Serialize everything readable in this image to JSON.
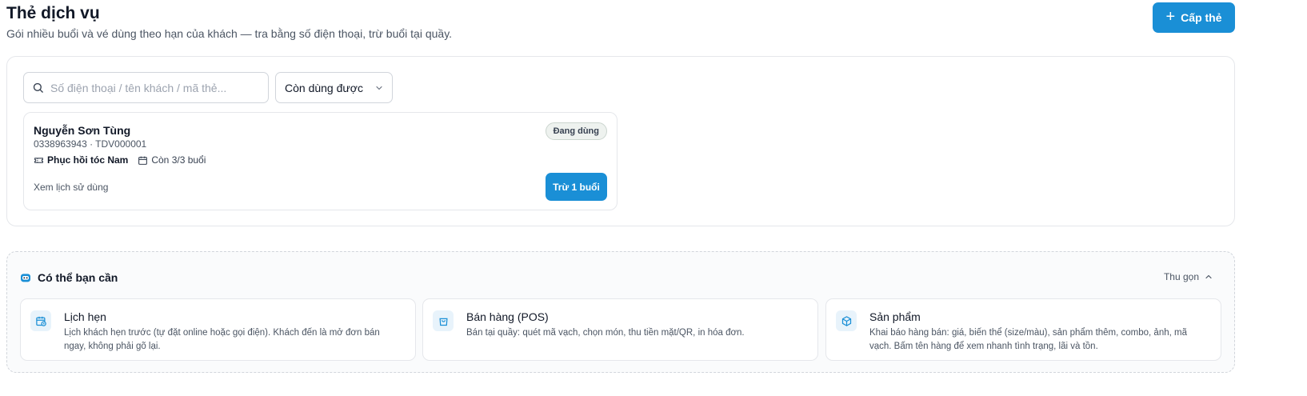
{
  "header": {
    "title": "Thẻ dịch vụ",
    "subtitle": "Gói nhiều buổi và vé dùng theo hạn của khách — tra bằng số điện thoại, trừ buổi tại quầy.",
    "issue_button": {
      "icon": "plus-icon",
      "label": "Cấp thẻ"
    }
  },
  "filters": {
    "search": {
      "icon": "search-icon",
      "placeholder": "Số điện thoại / tên khách / mã thẻ...",
      "value": ""
    },
    "status_select": {
      "selected": "Còn dùng được",
      "icon": "chevron-down-icon"
    }
  },
  "cards": [
    {
      "customer_name": "Nguyễn Sơn Tùng",
      "meta": "0338963943 · TDV000001",
      "status": "Đang dùng",
      "service": {
        "icon": "ticket-icon",
        "label": "Phục hồi tóc Nam"
      },
      "remaining": {
        "icon": "calendar-icon",
        "label": "Còn 3/3 buổi"
      },
      "history_link": "Xem lịch sử dùng",
      "deduct_button": "Trừ 1 buổi"
    }
  ],
  "suggestions": {
    "icon": "robot-icon",
    "title": "Có thể bạn cần",
    "collapse_label": "Thu gọn",
    "collapse_icon": "chevron-up-icon",
    "items": [
      {
        "icon": "calendar-clock-icon",
        "title": "Lịch hẹn",
        "description": "Lịch khách hẹn trước (tự đặt online hoặc gọi điện). Khách đến là mở đơn bán ngay, không phải gõ lại."
      },
      {
        "icon": "shopping-bag-icon",
        "title": "Bán hàng (POS)",
        "description": "Bán tại quầy: quét mã vạch, chọn món, thu tiền mặt/QR, in hóa đơn."
      },
      {
        "icon": "box-icon",
        "title": "Sản phẩm",
        "description": "Khai báo hàng bán: giá, biến thể (size/màu), sản phẩm thêm, combo, ảnh, mã vạch. Bấm tên hàng để xem nhanh tình trạng, lãi và tồn."
      }
    ]
  },
  "colors": {
    "primary": "#1a8fd6",
    "badge_bg": "#eef2ef",
    "border": "#e5e7eb",
    "icon_bg": "#e8f3fb"
  }
}
